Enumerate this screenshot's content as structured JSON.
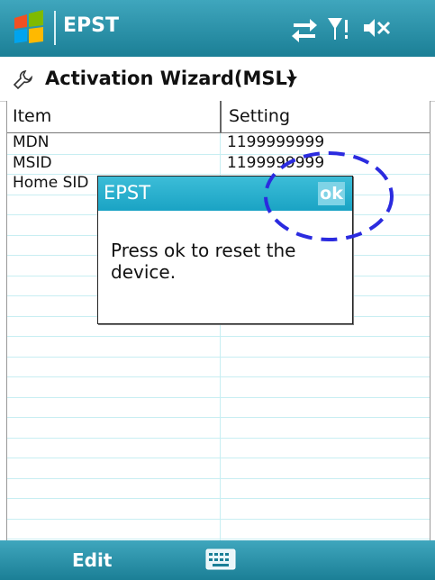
{
  "titlebar": {
    "app_name": "EPST"
  },
  "header": {
    "title": "Activation Wizard(MSL)"
  },
  "table": {
    "columns": [
      "Item",
      "Setting"
    ],
    "rows": [
      {
        "item": "MDN",
        "setting": "1199999999"
      },
      {
        "item": "MSID",
        "setting": "1199999999"
      },
      {
        "item": "Home SID",
        "setting": ""
      }
    ]
  },
  "dialog": {
    "title": "EPST",
    "ok_label": "ok",
    "message": "Press ok to reset the device."
  },
  "bottombar": {
    "left_softkey": "Edit"
  },
  "colors": {
    "bar": "#1b8aa3",
    "dialog_title": "#2ab0cf",
    "annotation": "#2b2bdf"
  }
}
